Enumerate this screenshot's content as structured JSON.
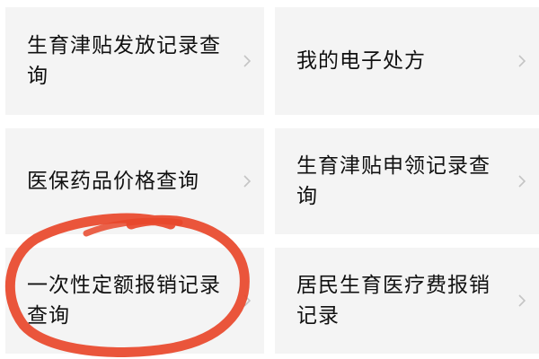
{
  "menu": {
    "items": [
      {
        "label": "生育津贴发放记录查询"
      },
      {
        "label": "我的电子处方"
      },
      {
        "label": "医保药品价格查询"
      },
      {
        "label": "生育津贴申领记录查询"
      },
      {
        "label": "一次性定额报销记录查询"
      },
      {
        "label": "居民生育医疗费报销记录"
      }
    ]
  },
  "annotation": {
    "color": "#e8472a",
    "icon": "hand-drawn-circle"
  },
  "colors": {
    "card_background": "#f4f4f4",
    "text": "#111111",
    "chevron": "#c4c4c4"
  }
}
